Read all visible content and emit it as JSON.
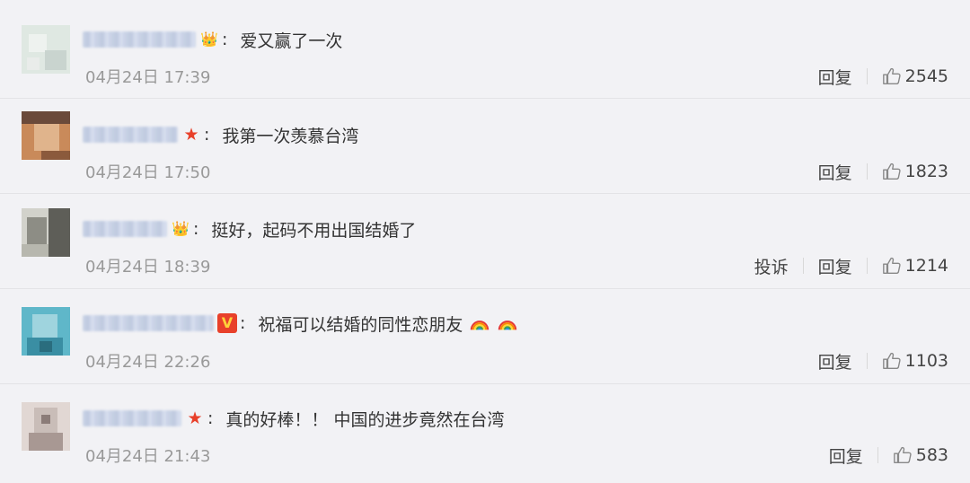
{
  "comments": [
    {
      "badge_icon": "vip-badge-icon",
      "badge_glyph": "👑",
      "text": "爱又赢了一次",
      "time": "04月24日 17:39",
      "actions": {
        "reply": "回复",
        "report": ""
      },
      "likes": "2545",
      "avatar_colors": [
        "#dfe8e2",
        "#eef2ef",
        "#c9d4cf",
        "#e9ecea"
      ]
    },
    {
      "badge_icon": "star-badge-icon",
      "badge_glyph": "★",
      "text": "我第一次羡慕台湾",
      "time": "04月24日 17:50",
      "actions": {
        "reply": "回复",
        "report": ""
      },
      "likes": "1823",
      "avatar_colors": [
        "#c98a5a",
        "#8b5a3c",
        "#e0b48c",
        "#6b4a3a"
      ]
    },
    {
      "badge_icon": "crown-badge-icon",
      "badge_glyph": "👑",
      "text": "挺好，起码不用出国结婚了",
      "time": "04月24日 18:39",
      "actions": {
        "reply": "回复",
        "report": "投诉"
      },
      "likes": "1214",
      "avatar_colors": [
        "#b7b7ae",
        "#8d8d85",
        "#d2d2cb",
        "#5e5e58"
      ]
    },
    {
      "badge_icon": "v-verified-badge-icon",
      "badge_glyph": "V",
      "text": "祝福可以结婚的同性恋朋友",
      "emoji_count": 2,
      "time": "04月24日 22:26",
      "actions": {
        "reply": "回复",
        "report": ""
      },
      "likes": "1103",
      "avatar_colors": [
        "#5fb7c9",
        "#3a8ea3",
        "#9fd4de",
        "#2a6d7e"
      ]
    },
    {
      "badge_icon": "star-badge-icon",
      "badge_glyph": "★",
      "text": "真的好棒！！ 中国的进步竟然在台湾",
      "time": "04月24日 21:43",
      "actions": {
        "reply": "回复",
        "report": ""
      },
      "likes": "583",
      "avatar_colors": [
        "#c9bdb8",
        "#a89893",
        "#e1d7d3",
        "#8b7c78"
      ]
    }
  ]
}
